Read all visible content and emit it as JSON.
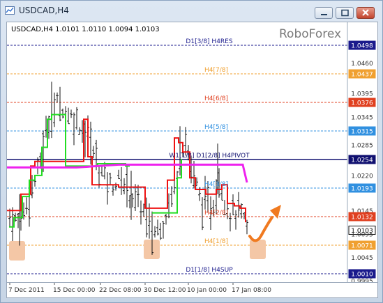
{
  "window": {
    "title": "USDCAD,H4"
  },
  "chart": {
    "info_line": "USDCAD,H4  1.0101 1.0110 1.0094 1.0103",
    "watermark": "RoboForex",
    "current_price": "1.0103"
  },
  "chart_data": {
    "type": "candlestick",
    "symbol": "USDCAD",
    "timeframe": "H4",
    "ohlc_last": {
      "open": 1.0101,
      "high": 1.011,
      "low": 1.0094,
      "close": 1.0103
    },
    "ylim": [
      0.9995,
      1.0498
    ],
    "x_tick_labels": [
      "7 Dec 2011",
      "15 Dec 00:00",
      "22 Dec 08:00",
      "30 Dec 12:00",
      "10 Jan 00:00",
      "17 Jan 08:00"
    ],
    "y_tick_labels": [
      "1.0498",
      "1.0460",
      "1.0437",
      "1.0395",
      "1.0376",
      "1.0345",
      "1.0315",
      "1.0285",
      "1.0254",
      "1.0220",
      "1.0193",
      "1.0145",
      "1.0132",
      "1.0103",
      "1.0095",
      "1.0071",
      "1.0045",
      "1.0010",
      "0.9995"
    ],
    "levels": [
      {
        "price": 1.0498,
        "label": "D1[3/8] H4RES",
        "color": "#1a1a8c",
        "style": "dashed"
      },
      {
        "price": 1.0437,
        "label": "H4[7/8]",
        "color": "#f0a030",
        "style": "dashed"
      },
      {
        "price": 1.0376,
        "label": "H4[6/8]",
        "color": "#e04020",
        "style": "dashed"
      },
      {
        "price": 1.0315,
        "label": "H4[5/8]",
        "color": "#3090e0",
        "style": "dashed"
      },
      {
        "price": 1.0254,
        "label": "W1[1/8] D1[2/8] H4PIVOT",
        "color": "#101070",
        "style": "solid"
      },
      {
        "price": 1.0193,
        "label": "H4[3/8]",
        "color": "#3090e0",
        "style": "dashed"
      },
      {
        "price": 1.0132,
        "label": "H4[2/8]",
        "color": "#e04020",
        "style": "dashed"
      },
      {
        "price": 1.0071,
        "label": "H4[1/8]",
        "color": "#f0a030",
        "style": "dashed"
      },
      {
        "price": 1.001,
        "label": "D1[1/8] H4SUP",
        "color": "#1a1a8c",
        "style": "dashed"
      }
    ],
    "colors": {
      "bars": "#111111",
      "support_line": "#22dd22",
      "resistance_line": "#ee1111",
      "pivot_line": "#ee22ee",
      "forecast_arrow": "#f07a20",
      "highlight_box": "#f4c7a6",
      "current_price_box": "#111111"
    }
  }
}
